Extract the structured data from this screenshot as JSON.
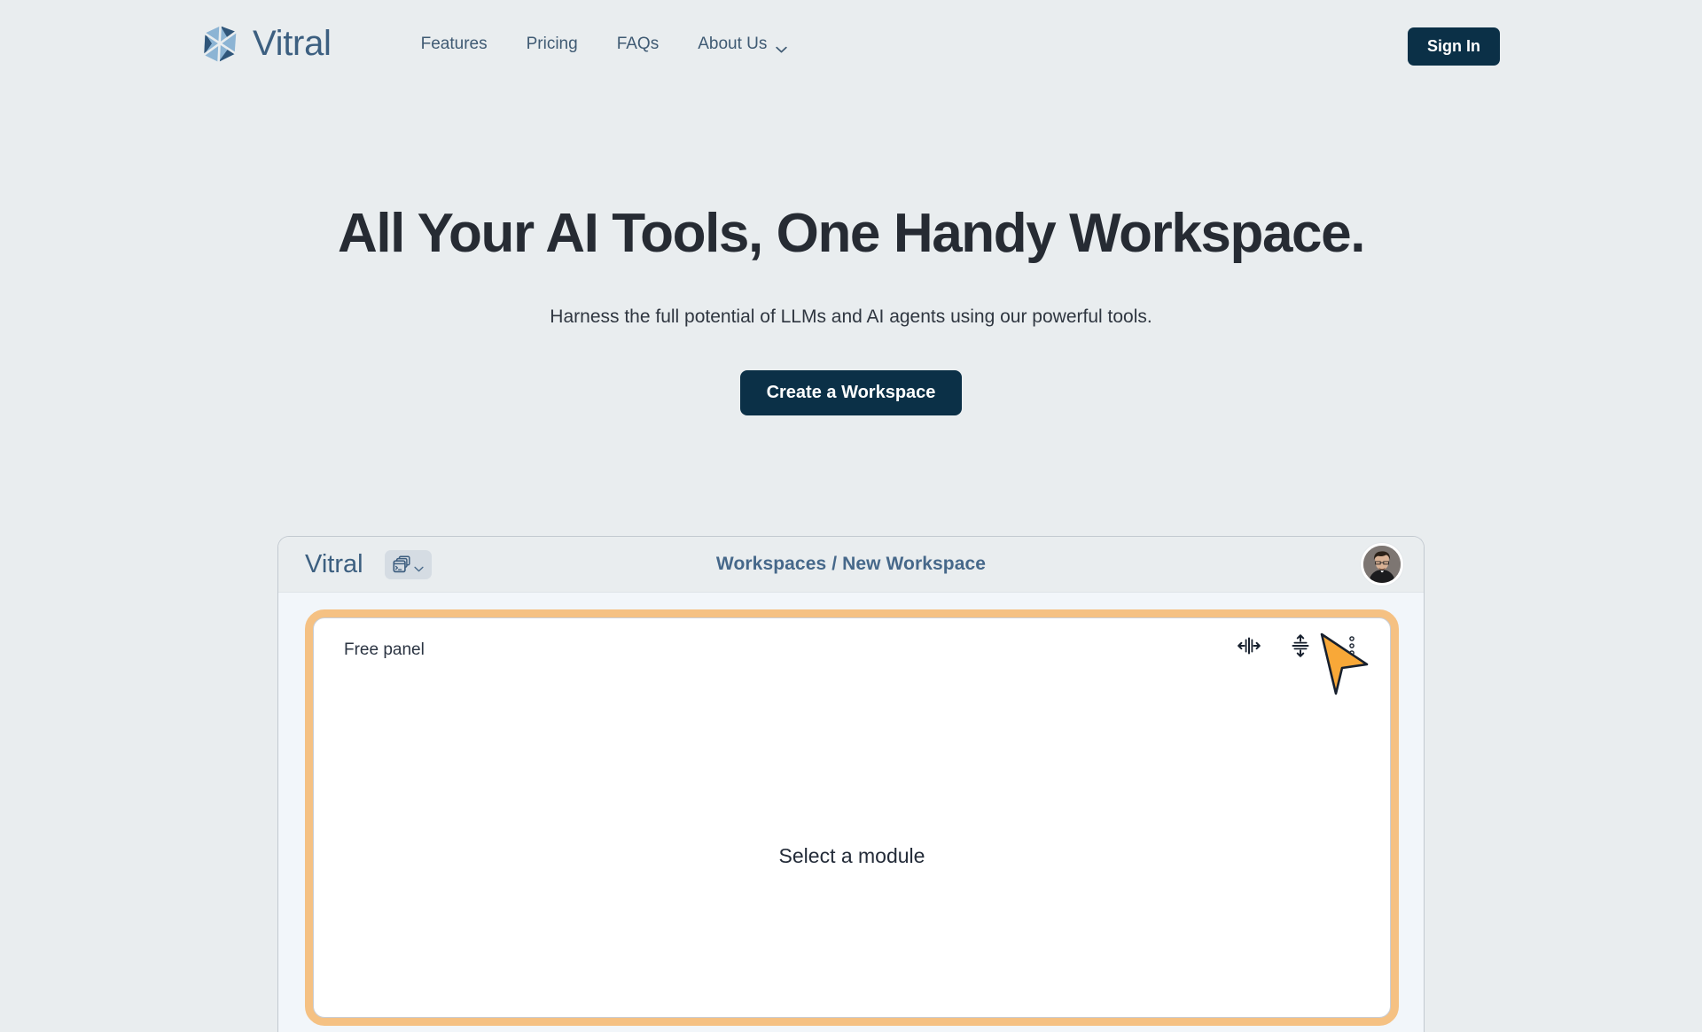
{
  "brand": {
    "name": "Vitral",
    "logo_icon": "gem-logo-icon",
    "logo_colors": {
      "light": "#8cb4d4",
      "dark": "#2f5579",
      "mid": "#6fa0c6"
    }
  },
  "nav": {
    "items": [
      {
        "label": "Features",
        "icon": null
      },
      {
        "label": "Pricing",
        "icon": null
      },
      {
        "label": "FAQs",
        "icon": null
      },
      {
        "label": "About Us",
        "icon": "chevron-down-icon"
      }
    ],
    "signin_label": "Sign In"
  },
  "hero": {
    "title": "All Your AI Tools, One Handy Workspace.",
    "subtitle": "Harness the full potential of LLMs and AI agents using our powerful tools.",
    "cta_label": "Create a Workspace"
  },
  "app_preview": {
    "brand_name": "Vitral",
    "switcher_icon": "stacked-windows-terminal-icon",
    "switcher_caret_icon": "chevron-down-icon",
    "breadcrumb": {
      "root": "Workspaces",
      "separator": "/",
      "current": "New Workspace",
      "full": "Workspaces  / New Workspace"
    },
    "avatar_icon": "user-avatar-photo",
    "panel": {
      "title": "Free panel",
      "empty_text": "Select a module",
      "focus_ring_color": "#f5c183",
      "tools": [
        {
          "name": "split-horizontal-icon",
          "label": "Split horizontally"
        },
        {
          "name": "split-vertical-icon",
          "label": "Split vertically"
        },
        {
          "name": "more-options-icon",
          "label": "More options"
        }
      ]
    },
    "cursor_icon": "arrow-cursor",
    "cursor_color": "#f8a838"
  },
  "colors": {
    "page_background": "#e9edef",
    "accent_dark": "#0b3047",
    "brand_blue": "#3c5f80",
    "focus_orange": "#f5c183"
  }
}
